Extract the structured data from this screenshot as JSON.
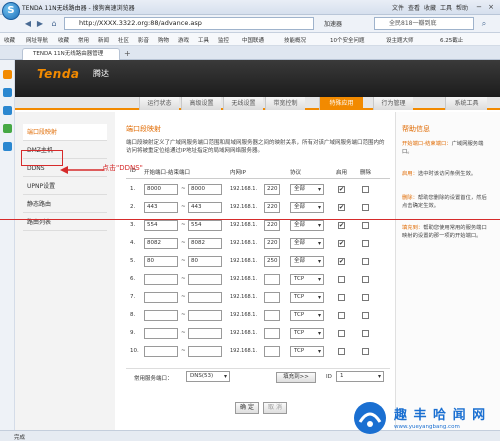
{
  "browser": {
    "title": "TENDA 11N无线路由器 - 搜狗高速浏览器",
    "menu": [
      "文件",
      "查看",
      "收藏",
      "工具",
      "帮助"
    ],
    "url": "http://XXXX.3322.org:88/advance.asp",
    "accelerator": "加速器",
    "search_placeholder": "全民818一瓣到底",
    "favorites": [
      "收藏",
      "网址导航",
      "收藏",
      "常用",
      "新闻",
      "社区",
      "影音",
      "购物",
      "游戏",
      "工具",
      "监控",
      "中国联通",
      "技能概况",
      "10个安全问题",
      "设主题大师",
      "6.25截止"
    ],
    "tab_title": "TENDA 11N无线路由器管理",
    "status": "完成",
    "colors": {
      "accent": "#f28a00",
      "annotation": "#d62b2b"
    }
  },
  "router": {
    "brand": "Tenda",
    "brand_cn": "腾达",
    "menu": [
      "运行状态",
      "高级设置",
      "无线设置",
      "带宽控制",
      "特殊应用",
      "行为管理",
      "系统工具"
    ],
    "active_menu": "特殊应用",
    "sidebar": [
      "端口段映射",
      "DMZ主机",
      "DDNS",
      "UPNP设置",
      "静态路由",
      "路由列表"
    ],
    "section_title": "端口段映射",
    "description": "端口段映射定义了广域网服务端口范围和局域网服务器之间的映射关系，所有对该广域网服务端口范围内的访问将被重定位给通过IP地址指定的局域网网络服务器。",
    "columns": [
      "ID",
      "开始端口-结束端口",
      "内网IP",
      "协议",
      "启用",
      "删除"
    ],
    "ip_prefix": "192.168.1.",
    "rows": [
      {
        "id": "1.",
        "start": "8000",
        "end": "8000",
        "ip": "220",
        "proto": "全部",
        "enabled": "✔"
      },
      {
        "id": "2.",
        "start": "443",
        "end": "443",
        "ip": "220",
        "proto": "全部",
        "enabled": "✔"
      },
      {
        "id": "3.",
        "start": "554",
        "end": "554",
        "ip": "220",
        "proto": "全部",
        "enabled": "✔"
      },
      {
        "id": "4.",
        "start": "8082",
        "end": "8082",
        "ip": "220",
        "proto": "全部",
        "enabled": "✔"
      },
      {
        "id": "5.",
        "start": "80",
        "end": "80",
        "ip": "250",
        "proto": "全部",
        "enabled": "✔"
      },
      {
        "id": "6.",
        "start": "",
        "end": "",
        "ip": "",
        "proto": "TCP",
        "enabled": ""
      },
      {
        "id": "7.",
        "start": "",
        "end": "",
        "ip": "",
        "proto": "TCP",
        "enabled": ""
      },
      {
        "id": "8.",
        "start": "",
        "end": "",
        "ip": "",
        "proto": "TCP",
        "enabled": ""
      },
      {
        "id": "9.",
        "start": "",
        "end": "",
        "ip": "",
        "proto": "TCP",
        "enabled": ""
      },
      {
        "id": "10.",
        "start": "",
        "end": "",
        "ip": "",
        "proto": "TCP",
        "enabled": ""
      }
    ],
    "common_label": "常用服务端口：",
    "common_service": "DNS(53)",
    "fill_button": "填充到>>",
    "id_label": "ID",
    "id_value": "1",
    "ok_button": "确 定",
    "cancel_button": "取 消",
    "help": {
      "title": "帮助信息",
      "items": [
        {
          "term": "开始端口-结束端口：",
          "text": "广域网服务端口。"
        },
        {
          "term": "启用：",
          "text": "选中时该访问条例生效。"
        },
        {
          "term": "删除：",
          "text": "帮助您删除的设置首位，然后点击确定生效。"
        },
        {
          "term": "填充到：",
          "text": "帮助您使用常用的服务端口映射的设置的那一项的开始端口。"
        }
      ]
    }
  },
  "annotation": "点击\"DDNS\"",
  "watermark": {
    "text": "趣 丰 哈 闻 网",
    "url": "www.yueyangbang.com"
  }
}
